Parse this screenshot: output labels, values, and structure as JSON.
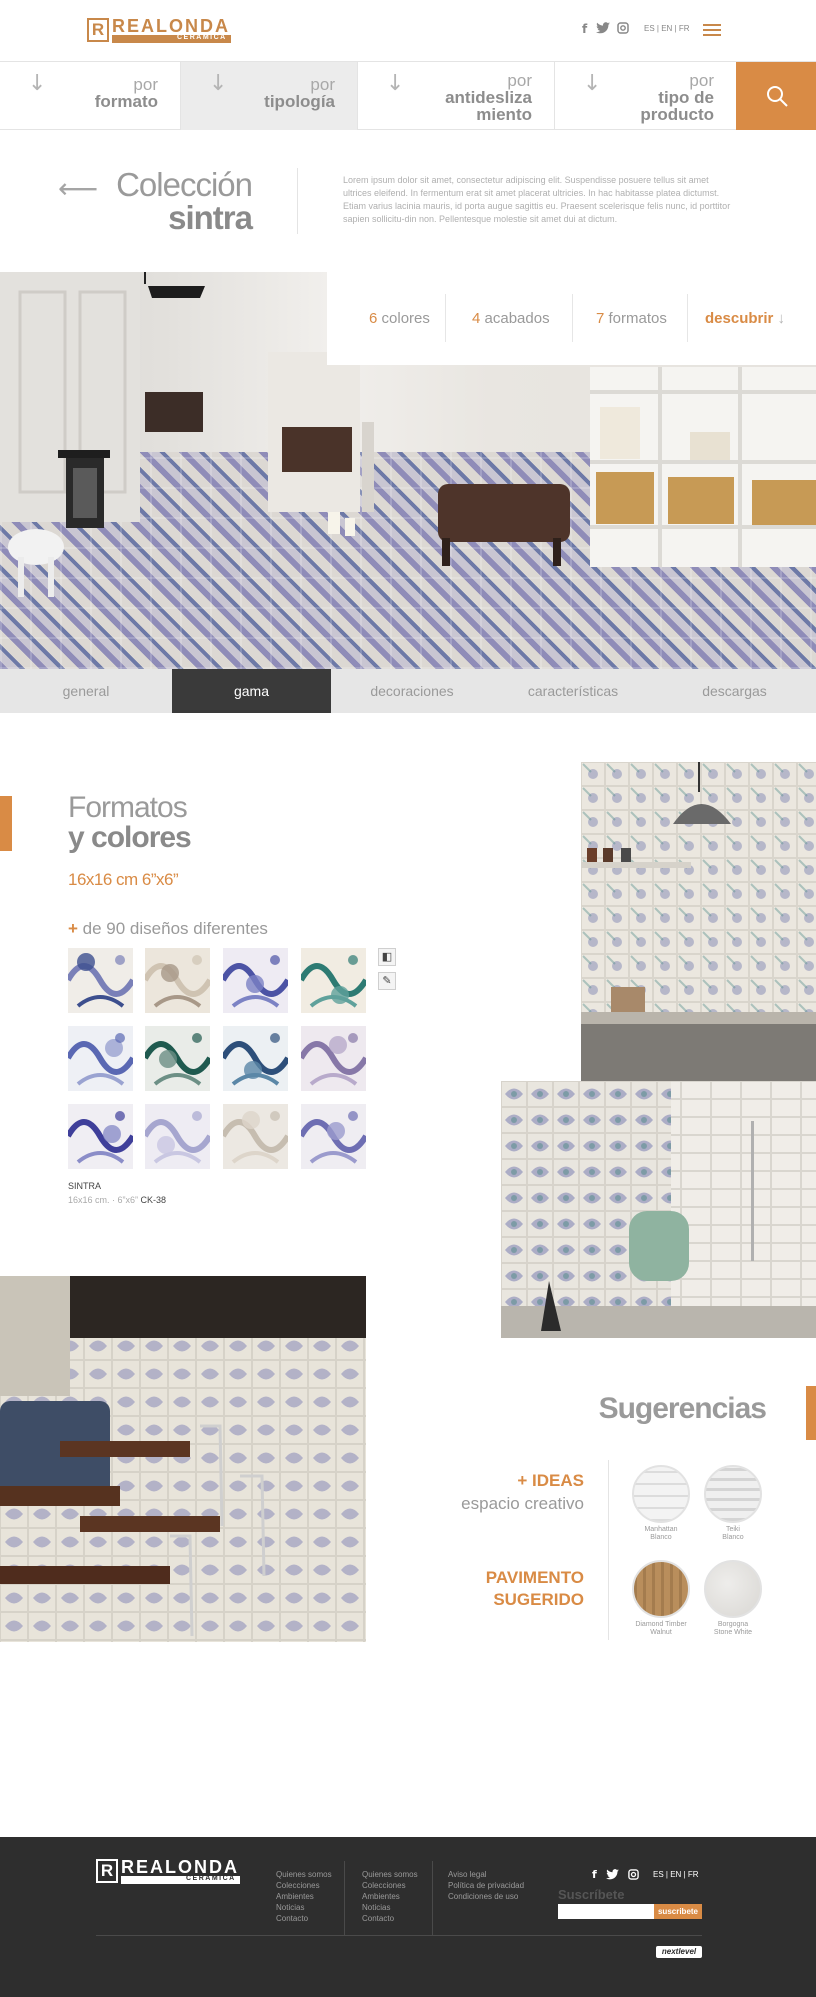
{
  "header": {
    "logo": {
      "name": "REALONDA",
      "sub": "CERAMICA"
    },
    "social": {
      "facebook": "f",
      "twitter": "t",
      "instagram": "◎"
    },
    "languages": "ES  |  EN  |  FR"
  },
  "filters": [
    {
      "line1": "por",
      "line2": "formato"
    },
    {
      "line1": "por",
      "line2": "tipología"
    },
    {
      "line1": "por",
      "line2": "antidesliza",
      "line3": "miento"
    },
    {
      "line1": "por",
      "line2": "tipo de",
      "line3": "producto"
    }
  ],
  "intro": {
    "title_line1": "Colección",
    "title_line2": "sintra",
    "text": "Lorem ipsum dolor sit amet, consectetur adipiscing elit. Suspendisse posuere tellus sit amet ultrices eleifend. In fermentum erat sit amet placerat ultricies. In hac habitasse platea dictumst. Etiam varius lacinia mauris, id porta augue sagittis eu. Praesent scelerisque felis nunc, id porttitor sapien sollicitu-din non. Pellentesque molestie sit amet dui at dictum."
  },
  "stats": {
    "colores_n": "6",
    "colores_label": "colores",
    "acabados_n": "4",
    "acabados_label": "acabados",
    "formatos_n": "7",
    "formatos_label": "formatos",
    "descubrir": "descubrir"
  },
  "tabs": [
    {
      "label": "general",
      "active": false
    },
    {
      "label": "gama",
      "active": true
    },
    {
      "label": "decoraciones",
      "active": false
    },
    {
      "label": "características",
      "active": false
    },
    {
      "label": "descargas",
      "active": false
    }
  ],
  "formatos": {
    "title_line1": "Formatos",
    "title_line2": "y colores",
    "size": "16x16 cm 6”x6”",
    "plus": "+",
    "designs": "de 90 diseños diferentes",
    "sku_name": "SINTRA",
    "sku_meta": "16x16 cm. · 6”x6”",
    "sku_code": "CK-38"
  },
  "sugerencias": {
    "title": "Sugerencias",
    "ideas_line1": "+ IDEAS",
    "ideas_line2": "espacio creativo",
    "pavimento_line1": "PAVIMENTO",
    "pavimento_line2": "SUGERIDO",
    "items": [
      {
        "line1": "Manhattan",
        "line2": "Blanco"
      },
      {
        "line1": "Teiki",
        "line2": "Blanco"
      },
      {
        "line1": "Diamond Timber",
        "line2": "Walnut"
      },
      {
        "line1": "Borgogna",
        "line2": "Stone White"
      }
    ]
  },
  "footer": {
    "logo": {
      "name": "REALONDA",
      "sub": "CERAMICA"
    },
    "col1": [
      "Quienes somos",
      "Colecciones",
      "Ambientes",
      "Noticias",
      "Contacto"
    ],
    "col2": [
      "Quienes somos",
      "Colecciones",
      "Ambientes",
      "Noticias",
      "Contacto"
    ],
    "col3": [
      "Aviso legal",
      "Política de privacidad",
      "Condiciones de uso"
    ],
    "social": {
      "facebook": "f",
      "twitter": "t",
      "instagram": "◎"
    },
    "languages": "ES  |  EN  |  FR",
    "subscribe_label": "Suscríbete",
    "subscribe_button": "suscribete",
    "credit": "nextlevel"
  },
  "colors": {
    "accent": "#d98b45",
    "dark": "#3a3a3a",
    "footer": "#2e2e2e"
  }
}
